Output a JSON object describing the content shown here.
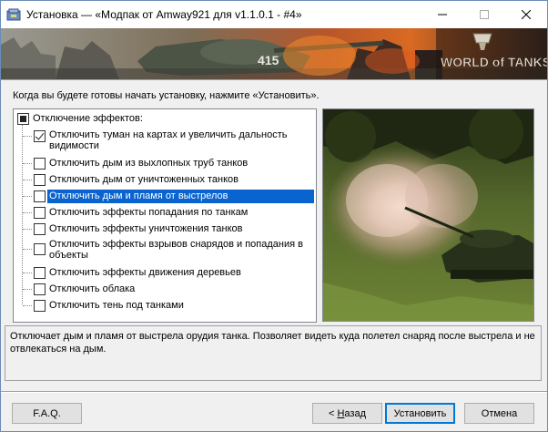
{
  "window": {
    "title": "Установка — «Модпак от Amway921 для v1.1.0.1 - #4»",
    "controls": {
      "minimize_icon": "minimize-icon",
      "maximize_icon": "maximize-icon",
      "close_icon": "close-icon"
    }
  },
  "banner": {
    "logo_text": "WORLD of TANKS"
  },
  "instruction": "Когда вы будете готовы начать установку, нажмите «Установить».",
  "tree": {
    "root": {
      "label": "Отключение эффектов:",
      "state": "partial"
    },
    "items": [
      {
        "label": "Отключить туман на картах и увеличить дальность",
        "label2": "видимости",
        "checked": true
      },
      {
        "label": "Отключить дым из выхлопных труб танков",
        "checked": false
      },
      {
        "label": "Отключить дым от уничтоженных танков",
        "checked": false
      },
      {
        "label": "Отключить дым и пламя от выстрелов",
        "checked": false,
        "selected": true
      },
      {
        "label": "Отключить эффекты попадания по танкам",
        "checked": false
      },
      {
        "label": "Отключить эффекты уничтожения танков",
        "checked": false
      },
      {
        "label": "Отключить эффекты взрывов снарядов и попадания в",
        "label2": "объекты",
        "checked": false
      },
      {
        "label": "Отключить эффекты движения деревьев",
        "checked": false
      },
      {
        "label": "Отключить облака",
        "checked": false
      },
      {
        "label": "Отключить тень под танками",
        "checked": false
      }
    ]
  },
  "description": "Отключает дым и пламя от выстрела орудия танка. Позволяет видеть куда полетел снаряд после выстрела и не отвлекаться на дым.",
  "buttons": {
    "faq": "F.A.Q.",
    "back_prefix": "< ",
    "back_accel": "Н",
    "back_rest": "азад",
    "install": "Установить",
    "cancel": "Отмена"
  },
  "colors": {
    "selection": "#0a64d0",
    "default_button_border": "#0078d7"
  }
}
